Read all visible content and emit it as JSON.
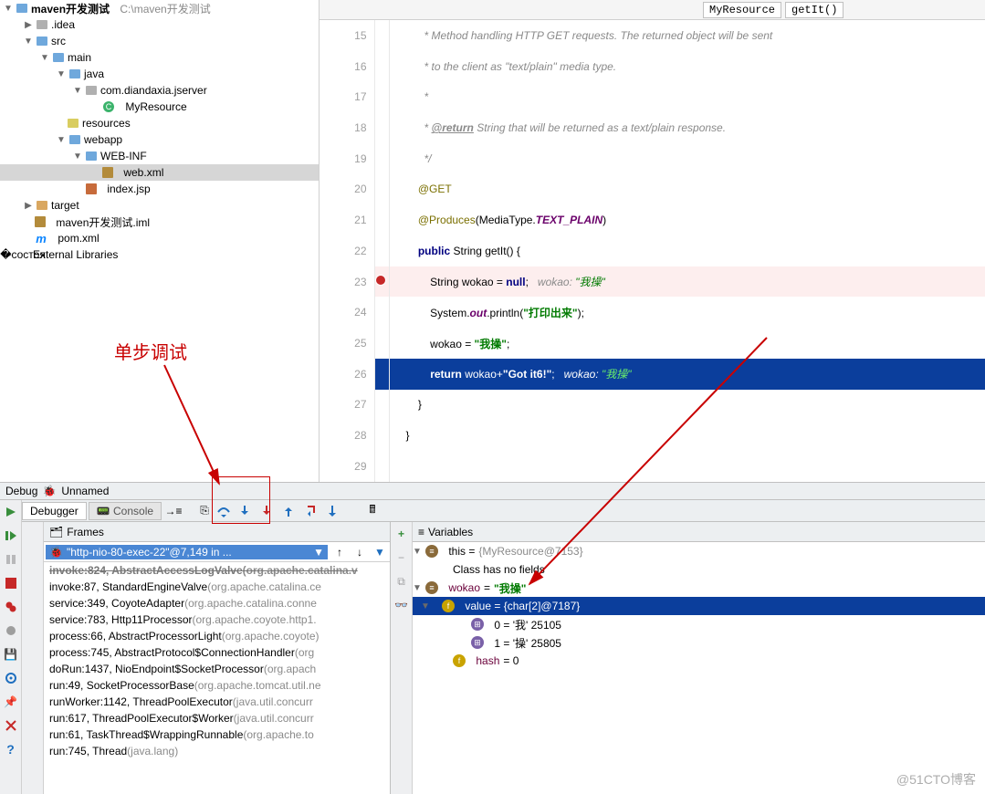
{
  "annotation_label": "单步调试",
  "breadcrumb": {
    "class": "MyResource",
    "method": "getIt()"
  },
  "project_tree": {
    "root": "maven开发测试",
    "root_path": "C:\\maven开发测试",
    "idea": ".idea",
    "src": "src",
    "main": "main",
    "java": "java",
    "package": "com.diandaxia.jserver",
    "class_name": "MyResource",
    "resources": "resources",
    "webapp": "webapp",
    "webinf": "WEB-INF",
    "webxml": "web.xml",
    "indexjsp": "index.jsp",
    "target": "target",
    "iml": "maven开发测试.iml",
    "pom": "pom.xml",
    "ext": "External Libraries"
  },
  "code": {
    "l15": " * Method handling HTTP GET requests. The returned object will be sent",
    "l16": " * to the client as \"text/plain\" media type.",
    "l17": " *",
    "l18_pre": " * ",
    "l18_tag": "@return",
    "l18_post": " String that will be returned as a text/plain response.",
    "l19": " */",
    "l20": "@GET",
    "l21_a": "@Produces",
    "l21_b": "(MediaType.",
    "l21_c": "TEXT_PLAIN",
    "l21_d": ")",
    "l22_a": "public",
    "l22_b": " String getIt() {",
    "l23_a": "    String wokao = ",
    "l23_b": "null",
    "l23_c": ";",
    "l23_hint_k": "wokao: ",
    "l23_hint_v": "\"我操\"",
    "l24_a": "    System.",
    "l24_b": "out",
    "l24_c": ".println(",
    "l24_d": "\"打印出来\"",
    "l24_e": ");",
    "l25_a": "    wokao = ",
    "l25_b": "\"我操\"",
    "l25_c": ";",
    "l26_a": "return",
    "l26_b": " wokao+",
    "l26_c": "\"Got it6!\"",
    "l26_d": ";",
    "l26_hint_k": "wokao: ",
    "l26_hint_v": "\"我操\"",
    "l27": "}",
    "l28": "}",
    "lines": [
      "15",
      "16",
      "17",
      "18",
      "19",
      "20",
      "21",
      "22",
      "23",
      "24",
      "25",
      "26",
      "27",
      "28",
      "29"
    ]
  },
  "debug": {
    "title": "Debug",
    "config": "Unnamed"
  },
  "tabs": {
    "debugger": "Debugger",
    "console": "Console"
  },
  "frames_title": "Frames",
  "thread": "\"http-nio-80-exec-22\"@7,149 in ...",
  "stack": [
    {
      "m": "invoke:824, AbstractAccessLogValve ",
      "l": "(org.apache.catalina.v",
      "strike": true
    },
    {
      "m": "invoke:87, StandardEngineValve ",
      "l": "(org.apache.catalina.ce"
    },
    {
      "m": "service:349, CoyoteAdapter ",
      "l": "(org.apache.catalina.conne"
    },
    {
      "m": "service:783, Http11Processor ",
      "l": "(org.apache.coyote.http1."
    },
    {
      "m": "process:66, AbstractProcessorLight ",
      "l": "(org.apache.coyote)"
    },
    {
      "m": "process:745, AbstractProtocol$ConnectionHandler ",
      "l": "(org"
    },
    {
      "m": "doRun:1437, NioEndpoint$SocketProcessor ",
      "l": "(org.apach"
    },
    {
      "m": "run:49, SocketProcessorBase ",
      "l": "(org.apache.tomcat.util.ne"
    },
    {
      "m": "runWorker:1142, ThreadPoolExecutor ",
      "l": "(java.util.concurr"
    },
    {
      "m": "run:617, ThreadPoolExecutor$Worker ",
      "l": "(java.util.concurr"
    },
    {
      "m": "run:61, TaskThread$WrappingRunnable ",
      "l": "(org.apache.to"
    },
    {
      "m": "run:745, Thread ",
      "l": "(java.lang)"
    }
  ],
  "variables_title": "Variables",
  "variables": {
    "this_lbl": "this = ",
    "this_val": "{MyResource@7153}",
    "nofields": "Class has no fields",
    "wokao_lbl": "wokao",
    "wokao_eq": " = ",
    "wokao_val": "\"我操\"",
    "value_lbl": "value = {char[2]@7187}",
    "idx0": "0 = '我' 25105",
    "idx1": "1 = '操' 25805",
    "hash": "hash",
    "hash_eq": " = 0"
  },
  "watermark": "@51CTO博客"
}
